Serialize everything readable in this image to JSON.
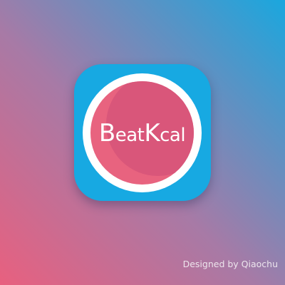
{
  "app_icon": {
    "wordmark": {
      "part1_initial": "B",
      "part1_rest": "eat",
      "part2_initial": "K",
      "part2_rest": "cal"
    },
    "colors": {
      "icon_background": "#17a9e2",
      "ring": "#ffffff",
      "disc": "#e8637f",
      "disc_shade": "#d9567a",
      "text": "#ffffff"
    }
  },
  "background": {
    "gradient_colors": [
      "#e8607f",
      "#a77aa6",
      "#1aa7de"
    ]
  },
  "credit": {
    "text": "Designed by Qiaochu"
  }
}
